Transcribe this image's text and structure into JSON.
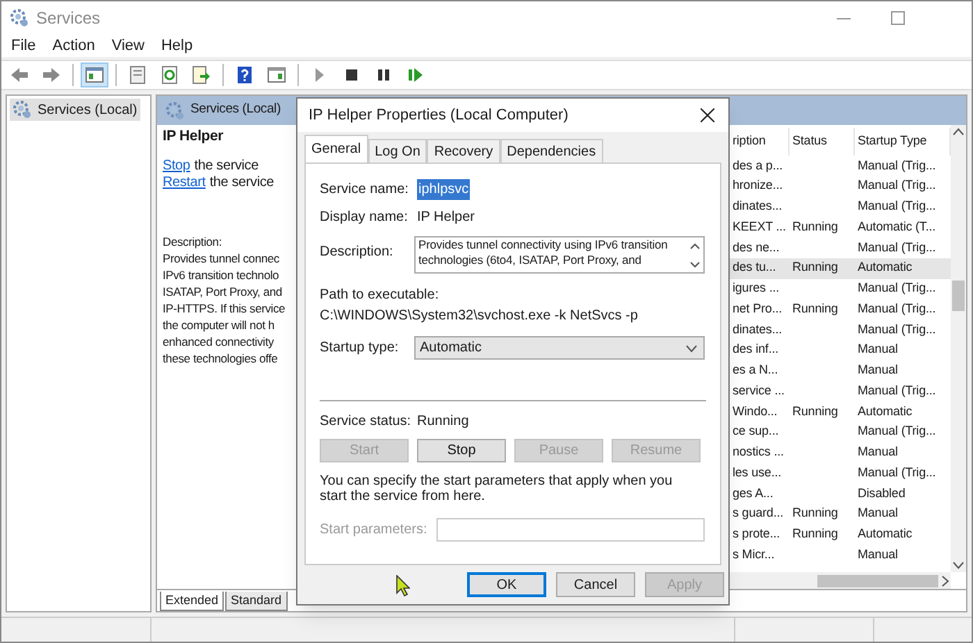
{
  "window": {
    "title": "Services"
  },
  "menu": [
    "File",
    "Action",
    "View",
    "Help"
  ],
  "toolbar": [
    {
      "kind": "back",
      "selected": false
    },
    {
      "kind": "forward",
      "selected": false
    },
    {
      "kind": "sep"
    },
    {
      "kind": "tree",
      "selected": true
    },
    {
      "kind": "sep"
    },
    {
      "kind": "props",
      "selected": false
    },
    {
      "kind": "refresh",
      "selected": false
    },
    {
      "kind": "export",
      "selected": false
    },
    {
      "kind": "sep"
    },
    {
      "kind": "help",
      "selected": false
    },
    {
      "kind": "view",
      "selected": false
    },
    {
      "kind": "sep"
    },
    {
      "kind": "play",
      "selected": false
    },
    {
      "kind": "stop",
      "selected": false
    },
    {
      "kind": "pause",
      "selected": false
    },
    {
      "kind": "resume",
      "selected": false
    }
  ],
  "tree": [
    {
      "label": "Services (Local)",
      "selected": true
    }
  ],
  "pane": {
    "header": "Services (Local)",
    "service_title": "IP Helper",
    "actions": [
      {
        "link": "Stop",
        "text": "the service"
      },
      {
        "link": "Restart",
        "text": "the service"
      }
    ],
    "description_label": "Description:",
    "description_lines": [
      "Provides tunnel connec",
      "IPv6 transition technolo",
      "ISATAP, Port Proxy, and",
      "IP-HTTPS. If this service",
      "the computer will not h",
      "enhanced connectivity",
      "these technologies offe"
    ]
  },
  "table": {
    "columns": [
      "ription",
      "Status",
      "Startup Type"
    ],
    "rows": [
      {
        "cells": [
          "des a p...",
          "",
          "Manual (Trig..."
        ],
        "selected": false
      },
      {
        "cells": [
          "hronize...",
          "",
          "Manual (Trig..."
        ],
        "selected": false
      },
      {
        "cells": [
          "dinates...",
          "",
          "Manual (Trig..."
        ],
        "selected": false
      },
      {
        "cells": [
          "KEEXT ...",
          "Running",
          "Automatic (T..."
        ],
        "selected": false
      },
      {
        "cells": [
          "des ne...",
          "",
          "Manual (Trig..."
        ],
        "selected": false
      },
      {
        "cells": [
          "des tu...",
          "Running",
          "Automatic"
        ],
        "selected": true
      },
      {
        "cells": [
          "igures ...",
          "",
          "Manual (Trig..."
        ],
        "selected": false
      },
      {
        "cells": [
          "net Pro...",
          "Running",
          "Manual (Trig..."
        ],
        "selected": false
      },
      {
        "cells": [
          "dinates...",
          "",
          "Manual (Trig..."
        ],
        "selected": false
      },
      {
        "cells": [
          "des inf...",
          "",
          "Manual"
        ],
        "selected": false
      },
      {
        "cells": [
          "es a N...",
          "",
          "Manual"
        ],
        "selected": false
      },
      {
        "cells": [
          "service ...",
          "",
          "Manual (Trig..."
        ],
        "selected": false
      },
      {
        "cells": [
          "Windo...",
          "Running",
          "Automatic"
        ],
        "selected": false
      },
      {
        "cells": [
          "ce sup...",
          "",
          "Manual (Trig..."
        ],
        "selected": false
      },
      {
        "cells": [
          "nostics ...",
          "",
          "Manual"
        ],
        "selected": false
      },
      {
        "cells": [
          "les use...",
          "",
          "Manual (Trig..."
        ],
        "selected": false
      },
      {
        "cells": [
          "ges A...",
          "",
          "Disabled"
        ],
        "selected": false
      },
      {
        "cells": [
          "s guard...",
          "Running",
          "Manual"
        ],
        "selected": false
      },
      {
        "cells": [
          "s prote...",
          "Running",
          "Automatic"
        ],
        "selected": false
      },
      {
        "cells": [
          "s Micr...",
          "",
          "Manual"
        ],
        "selected": false
      }
    ]
  },
  "view_tabs": [
    {
      "label": "Extended",
      "selected": true
    },
    {
      "label": "Standard",
      "selected": false
    }
  ],
  "dialog": {
    "title": "IP Helper Properties (Local Computer)",
    "tabs": [
      {
        "label": "General",
        "selected": true
      },
      {
        "label": "Log On",
        "selected": false
      },
      {
        "label": "Recovery",
        "selected": false
      },
      {
        "label": "Dependencies",
        "selected": false
      }
    ],
    "service_name_label": "Service name:",
    "service_name": "iphlpsvc",
    "display_name_label": "Display name:",
    "display_name": "IP Helper",
    "description_label": "Description:",
    "description_lines": [
      "Provides tunnel connectivity using IPv6 transition",
      "technologies (6to4, ISATAP, Port Proxy, and"
    ],
    "path_label": "Path to executable:",
    "path": "C:\\WINDOWS\\System32\\svchost.exe -k NetSvcs -p",
    "startup_label": "Startup type:",
    "startup_value": "Automatic",
    "status_label": "Service status:",
    "status_value": "Running",
    "service_buttons": [
      {
        "label": "Start",
        "disabled": true
      },
      {
        "label": "Stop",
        "disabled": false
      },
      {
        "label": "Pause",
        "disabled": true
      },
      {
        "label": "Resume",
        "disabled": true
      }
    ],
    "hint": "You can specify the start parameters that apply when you start the service from here.",
    "params_label": "Start parameters:",
    "params_disabled": true,
    "buttons": [
      {
        "label": "OK",
        "disabled": false,
        "default": true
      },
      {
        "label": "Cancel",
        "disabled": false,
        "default": false
      },
      {
        "label": "Apply",
        "disabled": true,
        "default": false
      }
    ]
  }
}
